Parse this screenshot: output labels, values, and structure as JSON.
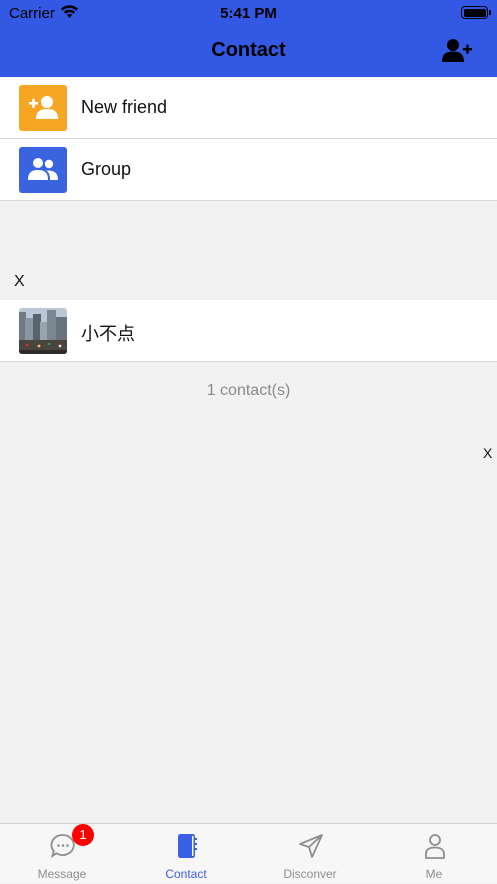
{
  "status_bar": {
    "carrier": "Carrier",
    "time": "5:41 PM"
  },
  "nav": {
    "title": "Contact",
    "add_icon": "add-user-icon"
  },
  "menu": [
    {
      "label": "New friend",
      "icon": "add-friend-icon",
      "color": "#f6a623"
    },
    {
      "label": "Group",
      "icon": "group-icon",
      "color": "#3a63e0"
    }
  ],
  "section": {
    "letter": "X"
  },
  "contacts": [
    {
      "name": "小不点",
      "avatar": "city-photo"
    }
  ],
  "footer": {
    "count_text": "1 contact(s)"
  },
  "index_bar": {
    "letter": "X"
  },
  "tabbar": {
    "tabs": [
      {
        "label": "Message",
        "icon": "chat-bubble-icon",
        "badge": "1",
        "active": false
      },
      {
        "label": "Contact",
        "icon": "contact-book-icon",
        "active": true
      },
      {
        "label": "Disconver",
        "icon": "paper-plane-icon",
        "active": false
      },
      {
        "label": "Me",
        "icon": "person-icon",
        "active": false
      }
    ]
  },
  "colors": {
    "header": "#3358e4",
    "accent": "#3a5fe3",
    "badge": "#ff0000",
    "background": "#f2f2f2"
  }
}
